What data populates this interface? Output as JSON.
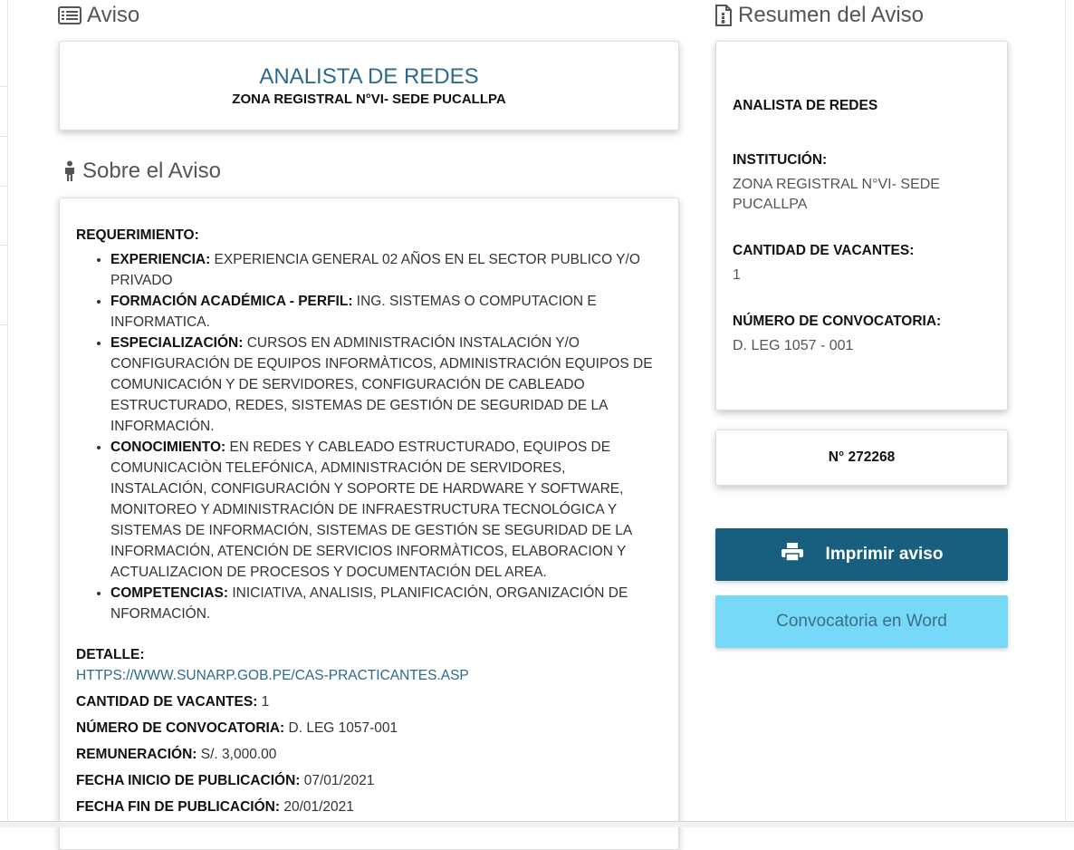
{
  "aviso_heading": "Aviso",
  "resumen_heading": "Resumen del Aviso",
  "sobre_heading": "Sobre el Aviso",
  "title_card": {
    "title": "ANALISTA DE REDES",
    "org": "ZONA REGISTRAL N°VI- SEDE PUCALLPA"
  },
  "about": {
    "requirement_label": "REQUERIMIENTO:",
    "requirements": [
      {
        "label": "EXPERIENCIA:",
        "text": " EXPERIENCIA GENERAL 02 AÑOS EN EL SECTOR PUBLICO Y/O PRIVADO"
      },
      {
        "label": "FORMACIÓN ACADÉMICA - PERFIL:",
        "text": " ING. SISTEMAS O COMPUTACION E INFORMATICA."
      },
      {
        "label": "ESPECIALIZACIÓN:",
        "text": " CURSOS EN ADMINISTRACIÓN INSTALACIÓN Y/O CONFIGURACIÓN DE EQUIPOS INFORMÀTICOS, ADMINISTRACIÓN EQUIPOS DE COMUNICACIÓN Y DE SERVIDORES, CONFIGURACIÓN DE CABLEADO ESTRUCTURADO, REDES, SISTEMAS DE GESTIÓN DE SEGURIDAD DE LA INFORMACIÓN."
      },
      {
        "label": "CONOCIMIENTO:",
        "text": " EN REDES Y CABLEADO ESTRUCTURADO, EQUIPOS DE COMUNICACIÒN TELEFÓNICA, ADMINISTRACIÓN DE SERVIDORES, INSTALACIÓN, CONFIGURACIÓN Y SOPORTE DE HARDWARE Y SOFTWARE, MONITOREO Y ADMINISTRACIÓN DE INFRAESTRUCTURA TECNOLÓGICA Y SISTEMAS DE INFORMACIÓN, SISTEMAS DE GESTIÓN SE SEGURIDAD DE LA INFORMACIÓN, ATENCIÓN DE SERVICIOS INFORMÀTICOS, ELABORACION Y ACTUALIZACION DE PROCESOS Y DOCUMENTACIÓN DEL AREA."
      },
      {
        "label": "COMPETENCIAS:",
        "text": " INICIATIVA, ANALISIS, PLANIFICACIÓN, ORGANIZACIÓN DE NFORMACIÓN."
      }
    ],
    "detail_label": "DETALLE:",
    "detail_link": "HTTPS://WWW.SUNARP.GOB.PE/CAS-PRACTICANTES.ASP",
    "vacantes_label": "CANTIDAD DE VACANTES:",
    "vacantes_value": " 1",
    "convocatoria_label": "NÚMERO DE CONVOCATORIA:",
    "convocatoria_value": " D. LEG 1057-001",
    "remuneracion_label": "REMUNERACIÓN:",
    "remuneracion_value": " S/. 3,000.00",
    "inicio_label": "FECHA INICIO DE PUBLICACIÓN:",
    "inicio_value": " 07/01/2021",
    "fin_label": "FECHA FIN DE PUBLICACIÓN:",
    "fin_value": " 20/01/2021"
  },
  "summary": {
    "title": "ANALISTA DE REDES",
    "institucion_label": "INSTITUCIÓN:",
    "institucion_value": "ZONA REGISTRAL N°VI- SEDE PUCALLPA",
    "vacantes_label": "CANTIDAD DE VACANTES:",
    "vacantes_value": "1",
    "convocatoria_label": "NÚMERO DE CONVOCATORIA:",
    "convocatoria_value": "D. LEG 1057 - 001"
  },
  "aviso_number": "N° 272268",
  "buttons": {
    "print_label": "Imprimir aviso",
    "word_label": "Convocatoria en Word"
  },
  "colors": {
    "title_blue": "#2e6a8a",
    "print_button": "#175e7f",
    "word_button": "#75d9f7"
  },
  "icons": {
    "aviso": "list-icon",
    "resumen": "document-icon",
    "sobre": "person-icon",
    "print": "printer-icon"
  }
}
